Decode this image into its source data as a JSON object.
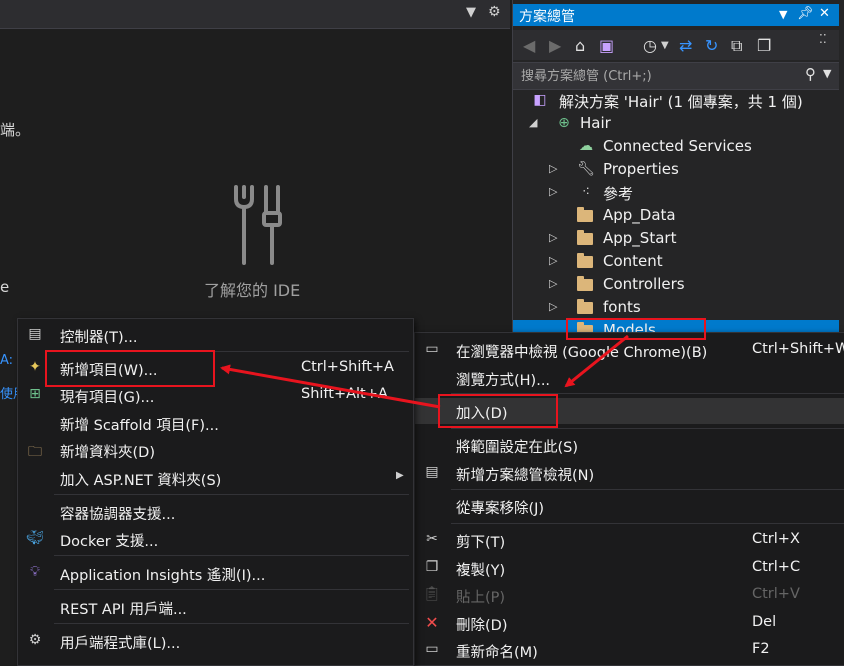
{
  "left_pane": {
    "ide_label": "了解您的 IDE",
    "fragment_end": "端。",
    "fragment_e": "e",
    "fragment_a": "A:",
    "fragment_use": "使用"
  },
  "solution_explorer": {
    "title": "方案總管",
    "search_placeholder": "搜尋方案總管 (Ctrl+;)",
    "tree": [
      {
        "label": "解決方案 'Hair' (1 個專案，共 1 個)",
        "icon": "solution-icon"
      },
      {
        "label": "Hair",
        "icon": "web-project-icon"
      },
      {
        "label": "Connected Services",
        "icon": "connected-services-icon"
      },
      {
        "label": "Properties",
        "icon": "wrench-icon"
      },
      {
        "label": "參考",
        "icon": "references-icon"
      },
      {
        "label": "App_Data",
        "icon": "folder-icon"
      },
      {
        "label": "App_Start",
        "icon": "folder-icon"
      },
      {
        "label": "Content",
        "icon": "folder-icon"
      },
      {
        "label": "Controllers",
        "icon": "folder-icon"
      },
      {
        "label": "fonts",
        "icon": "folder-icon"
      },
      {
        "label": "Models",
        "icon": "folder-icon"
      }
    ]
  },
  "context_menu": {
    "items": [
      {
        "label": "在瀏覽器中檢視 (Google Chrome)(B)",
        "shortcut": "Ctrl+Shift+W"
      },
      {
        "label": "瀏覽方式(H)..."
      },
      {
        "label": "加入(D)"
      },
      {
        "label": "將範圍設定在此(S)"
      },
      {
        "label": "新增方案總管檢視(N)"
      },
      {
        "label": "從專案移除(J)"
      },
      {
        "label": "剪下(T)",
        "shortcut": "Ctrl+X"
      },
      {
        "label": "複製(Y)",
        "shortcut": "Ctrl+C"
      },
      {
        "label": "貼上(P)",
        "shortcut": "Ctrl+V"
      },
      {
        "label": "刪除(D)",
        "shortcut": "Del"
      },
      {
        "label": "重新命名(M)",
        "shortcut": "F2"
      }
    ]
  },
  "add_submenu": {
    "items": [
      {
        "label": "控制器(T)..."
      },
      {
        "label": "新增項目(W)...",
        "shortcut": "Ctrl+Shift+A"
      },
      {
        "label": "現有項目(G)...",
        "shortcut": "Shift+Alt+A"
      },
      {
        "label": "新增 Scaffold 項目(F)..."
      },
      {
        "label": "新增資料夾(D)"
      },
      {
        "label": "加入 ASP.NET 資料夾(S)"
      },
      {
        "label": "容器協調器支援..."
      },
      {
        "label": "Docker 支援..."
      },
      {
        "label": "Application Insights 遙測(I)..."
      },
      {
        "label": "REST API 用戶端..."
      },
      {
        "label": "用戶端程式庫(L)..."
      }
    ]
  },
  "colors": {
    "accent": "#007acc",
    "annotation": "#e8141e",
    "menu_bg": "#1b1b1c",
    "panel_bg": "#252526"
  }
}
